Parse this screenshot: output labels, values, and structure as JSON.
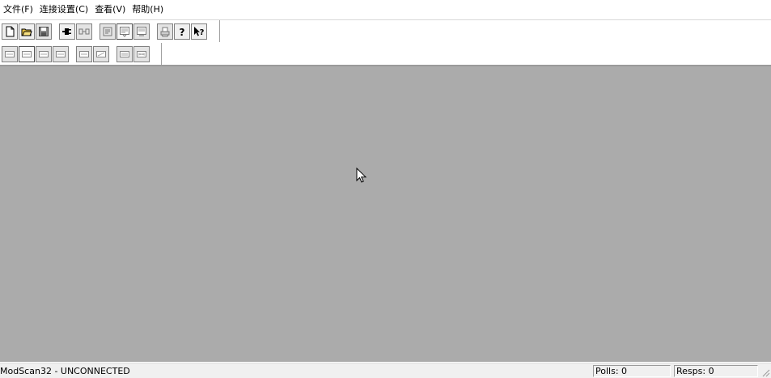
{
  "menu": {
    "file": "文件(F)",
    "connection": "连接设置(C)",
    "view": "查看(V)",
    "help": "帮助(H)"
  },
  "toolbar_main": [
    {
      "icon": "new-document-icon"
    },
    {
      "icon": "open-folder-icon"
    },
    {
      "icon": "save-disk-icon"
    },
    {
      "icon": "connect-icon"
    },
    {
      "icon": "disconnect-icon"
    },
    {
      "icon": "display-config-icon"
    },
    {
      "icon": "window-register-icon"
    },
    {
      "icon": "window-data-icon"
    },
    {
      "icon": "print-icon"
    },
    {
      "icon": "about-help-icon"
    },
    {
      "icon": "context-help-icon"
    }
  ],
  "toolbar_display": [
    {
      "icon": "display-format-binary-icon"
    },
    {
      "icon": "display-format-decimal-icon"
    },
    {
      "icon": "display-format-hex-icon"
    },
    {
      "icon": "display-format-hex-alt-icon"
    },
    {
      "icon": "display-format-float-icon"
    },
    {
      "icon": "display-format-float-swapped-icon"
    },
    {
      "icon": "display-format-double-icon"
    },
    {
      "icon": "display-format-double-swapped-icon"
    }
  ],
  "colors": {
    "client_background": "#ababab",
    "toolbar_background": "#ffffff",
    "statusbar_background": "#f0f0f0"
  },
  "status": {
    "main": "ModScan32 - UNCONNECTED",
    "polls": "Polls: 0",
    "resps": "Resps: 0"
  }
}
